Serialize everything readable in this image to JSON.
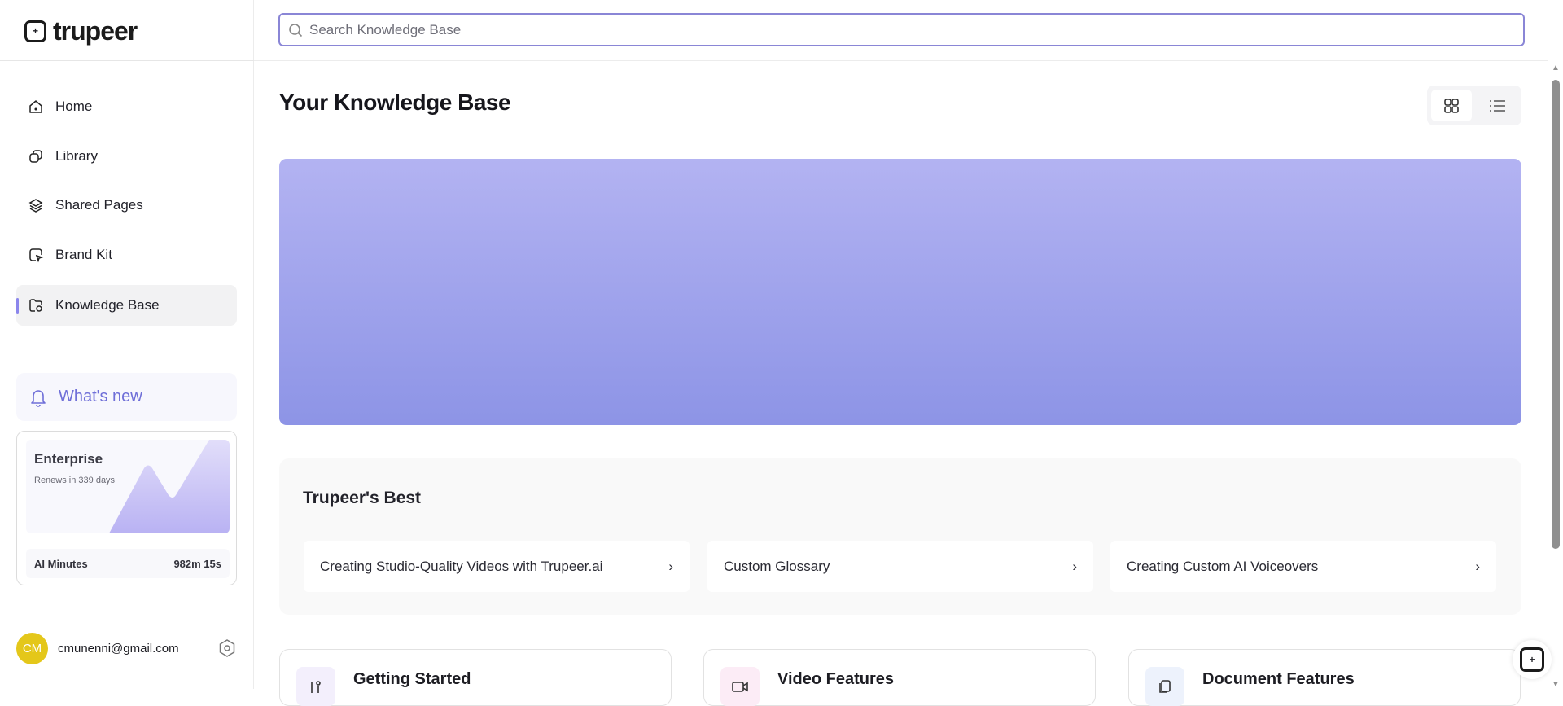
{
  "brand": {
    "name": "trupeer"
  },
  "sidebar": {
    "items": [
      {
        "label": "Home",
        "icon": "home-icon"
      },
      {
        "label": "Library",
        "icon": "library-icon"
      },
      {
        "label": "Shared Pages",
        "icon": "layers-icon"
      },
      {
        "label": "Brand Kit",
        "icon": "brand-kit-icon"
      },
      {
        "label": "Knowledge Base",
        "icon": "folder-icon",
        "active": true
      }
    ],
    "whats_new": "What's new",
    "plan": {
      "name": "Enterprise",
      "renews": "Renews in 339 days",
      "minutes_label": "AI Minutes",
      "minutes_value": "982m 15s"
    },
    "user": {
      "initials": "CM",
      "email": "cmunenni@gmail.com"
    }
  },
  "search": {
    "placeholder": "Search Knowledge Base",
    "value": ""
  },
  "main": {
    "title": "Your Knowledge Base",
    "best": {
      "title": "Trupeer's Best",
      "items": [
        "Creating Studio-Quality Videos with Trupeer.ai",
        "Custom Glossary",
        "Creating Custom AI Voiceovers"
      ]
    },
    "categories": [
      {
        "title": "Getting Started",
        "color": "#f3effc"
      },
      {
        "title": "Video Features",
        "color": "#fcecf6"
      },
      {
        "title": "Document Features",
        "color": "#edf2fc"
      }
    ]
  },
  "colors": {
    "accent": "#8b86ec",
    "banner_top": "#b3b3f2",
    "banner_bottom": "#8d94e6",
    "avatar": "#e4c71a"
  }
}
